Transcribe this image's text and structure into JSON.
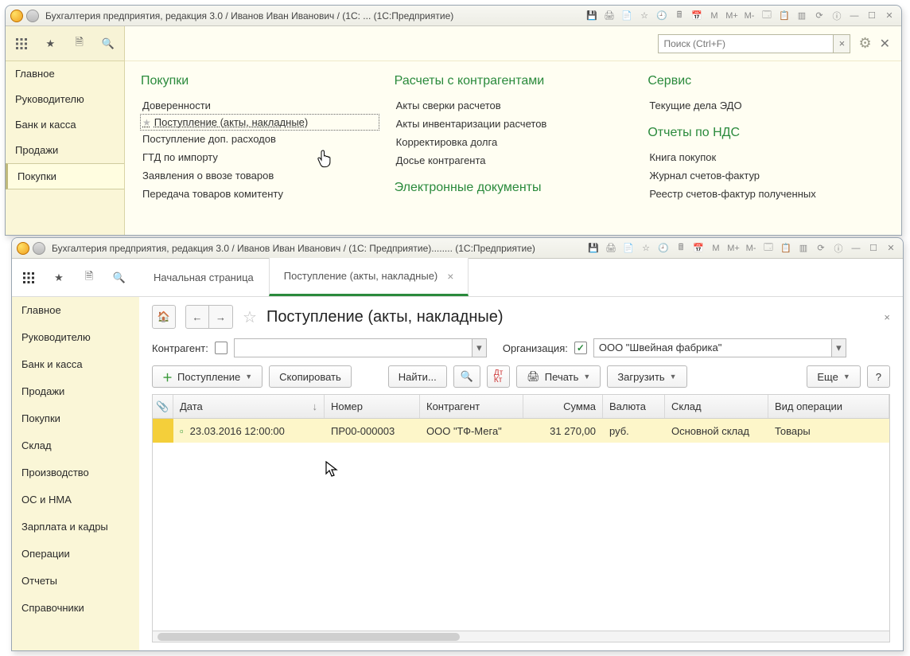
{
  "w1": {
    "title": "Бухгалтерия предприятия, редакция 3.0 / Иванов Иван Иванович / (1С: ...  (1С:Предприятие)",
    "search_placeholder": "Поиск (Ctrl+F)",
    "sidebar": [
      "Главное",
      "Руководителю",
      "Банк и касса",
      "Продажи",
      "Покупки"
    ],
    "active_sidebar_index": 4,
    "columns": {
      "purchases": {
        "head": "Покупки",
        "links": [
          "Доверенности",
          "Поступление (акты, накладные)",
          "Поступление доп. расходов",
          "ГТД по импорту",
          "Заявления о ввозе товаров",
          "Передача товаров комитенту"
        ]
      },
      "accounts": {
        "head": "Расчеты с контрагентами",
        "links": [
          "Акты сверки расчетов",
          "Акты инвентаризации расчетов",
          "Корректировка долга",
          "Досье контрагента"
        ],
        "second_head": "Электронные документы"
      },
      "service": {
        "head": "Сервис",
        "links": [
          "Текущие дела ЭДО"
        ],
        "second_head": "Отчеты по НДС",
        "links2": [
          "Книга покупок",
          "Журнал счетов-фактур",
          "Реестр счетов-фактур полученных"
        ]
      }
    }
  },
  "w2": {
    "title": "Бухгалтерия предприятия, редакция 3.0 / Иванов Иван Иванович / (1С: Предприятие)........ (1С:Предприятие)",
    "sidebar": [
      "Главное",
      "Руководителю",
      "Банк и касса",
      "Продажи",
      "Покупки",
      "Склад",
      "Производство",
      "ОС и НМА",
      "Зарплата и кадры",
      "Операции",
      "Отчеты",
      "Справочники"
    ],
    "tabs": {
      "home": "Начальная страница",
      "active": "Поступление (акты, накладные)"
    },
    "page_title": "Поступление (акты, накладные)",
    "filter": {
      "contragent_label": "Контрагент:",
      "org_label": "Организация:",
      "org_value": "ООО \"Швейная фабрика\""
    },
    "buttons": {
      "add": "Поступление",
      "copy": "Скопировать",
      "find": "Найти...",
      "print": "Печать",
      "load": "Загрузить",
      "more": "Еще"
    },
    "table": {
      "headers": {
        "date": "Дата",
        "number": "Номер",
        "contragent": "Контрагент",
        "sum": "Сумма",
        "currency": "Валюта",
        "warehouse": "Склад",
        "op": "Вид операции"
      },
      "row": {
        "date": "23.03.2016 12:00:00",
        "number": "ПР00-000003",
        "contragent": "ООО \"ТФ-Мега\"",
        "sum": "31 270,00",
        "currency": "руб.",
        "warehouse": "Основной склад",
        "op": "Товары"
      }
    }
  },
  "m_labels": {
    "m": "M",
    "mp": "M+",
    "mm": "M-"
  }
}
